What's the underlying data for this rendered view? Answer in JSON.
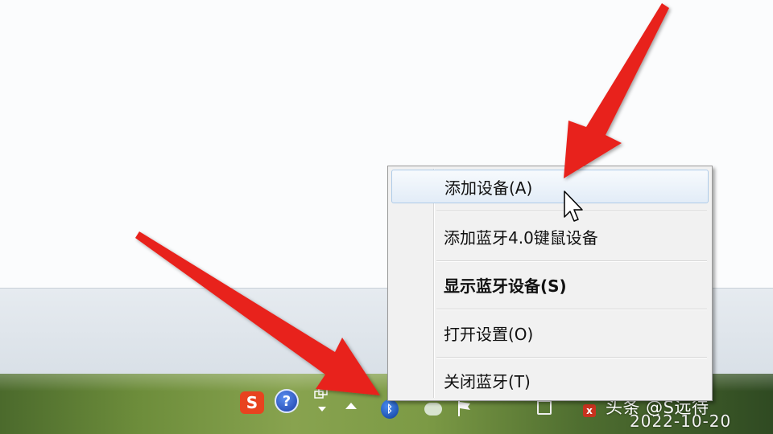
{
  "context_menu": {
    "items": [
      {
        "label": "添加设备(A)",
        "state": "hover"
      },
      {
        "label": "添加蓝牙4.0键鼠设备"
      },
      {
        "label": "显示蓝牙设备(S)",
        "bold": true
      },
      {
        "label": "打开设置(O)"
      },
      {
        "label": "关闭蓝牙(T)"
      }
    ]
  },
  "tray": {
    "sogou_glyph": "S",
    "help_glyph": "?",
    "bluetooth_glyph": "ᛒ",
    "close_glyph": "x",
    "icons": [
      "sogou-icon",
      "help-icon",
      "window-icon",
      "show-hidden-icons-arrow",
      "bluetooth-icon",
      "chat-icon",
      "flag-icon",
      "device-icon",
      "close-icon"
    ]
  },
  "watermark": "头条 @S远待",
  "clock": {
    "date": "2022-10-20"
  },
  "colors": {
    "arrow": "#e8231c",
    "menu_hover_border": "#aecbe8",
    "menu_bg": "#f1f1f1"
  }
}
